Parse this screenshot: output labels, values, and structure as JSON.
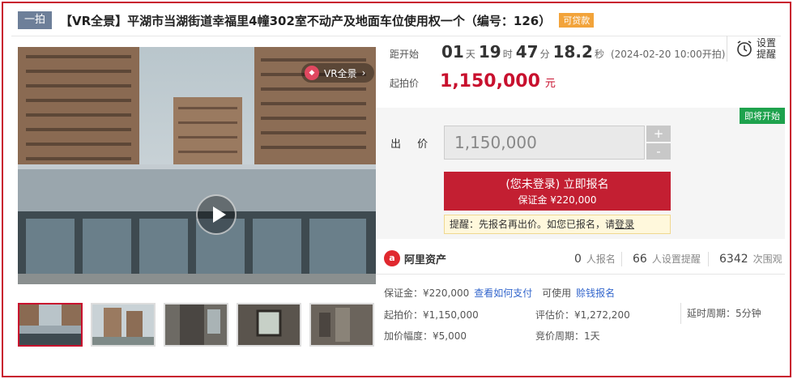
{
  "header": {
    "tag": "一拍",
    "title": "【VR全景】平湖市当湖街道幸福里4幢302室不动产及地面车位使用权一个（编号：126）",
    "loan_tag": "可贷款"
  },
  "media": {
    "vr_badge": "VR全景",
    "thumbnail_count": 5
  },
  "countdown": {
    "label": "距开始",
    "days": "01",
    "day_unit": "天",
    "hours": "19",
    "hour_unit": "时",
    "minutes": "47",
    "minute_unit": "分",
    "seconds": "18.2",
    "second_unit": "秒",
    "start_time": "(2024-02-20 10:00开拍)"
  },
  "remind": {
    "line1": "设置",
    "line2": "提醒"
  },
  "start_price": {
    "label": "起拍价",
    "value": "1,150,000",
    "unit": "元"
  },
  "bid": {
    "status_tag": "即将开始",
    "label": "出 价",
    "input_value": "1,150,000",
    "plus": "+",
    "minus": "-",
    "signup_main": "(您未登录) 立即报名",
    "signup_sub": "保证金 ¥220,000",
    "hint_text": "提醒：先报名再出价。如您已报名，请",
    "hint_link": "登录"
  },
  "stats": {
    "brand": "阿里资产",
    "signups_num": "0",
    "signups_unit": "人报名",
    "reminders_num": "66",
    "reminders_unit": "人设置提醒",
    "views_num": "6342",
    "views_unit": "次围观"
  },
  "details": {
    "deposit_label": "保证金：¥220,000",
    "deposit_link": "查看如何支付",
    "deposit_usable": "可使用",
    "deposit_usable_link": "赊钱报名",
    "start_price": "起拍价：¥1,150,000",
    "appraisal": "评估价：¥1,272,200",
    "delay": "延时周期：5分钟",
    "increment": "加价幅度：¥5,000",
    "bid_period": "竞价周期：1天"
  },
  "colors": {
    "accent": "#c8102e",
    "loan": "#f2a33a",
    "status_green": "#1ea24d",
    "link": "#3366cc"
  }
}
